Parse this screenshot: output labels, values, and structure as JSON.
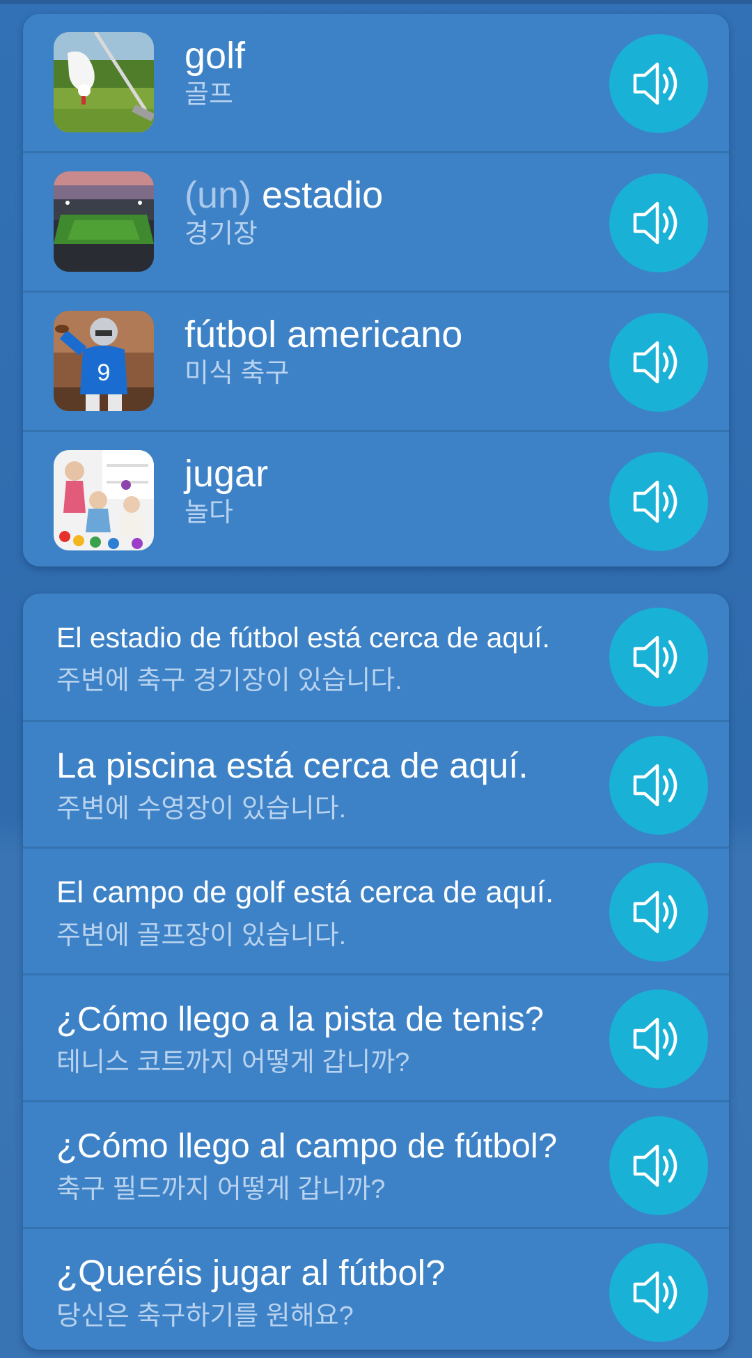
{
  "colors": {
    "card": "#3d82c6",
    "background": "#3271b5",
    "speaker_button": "#19b1d6",
    "article_text": "#a9c8ea",
    "translation_text": "#b8d2ef"
  },
  "vocabulary": [
    {
      "article": "",
      "term": "golf",
      "translation": "골프",
      "image": "golf-photo",
      "icon": "speaker-icon"
    },
    {
      "article": "(un)",
      "term": "estadio",
      "translation": "경기장",
      "image": "stadium-photo",
      "icon": "speaker-icon"
    },
    {
      "article": "",
      "term": "fútbol americano",
      "translation": "미식 축구",
      "image": "american-football-photo",
      "icon": "speaker-icon"
    },
    {
      "article": "",
      "term": "jugar",
      "translation": "놀다",
      "image": "children-playing-photo",
      "icon": "speaker-icon"
    }
  ],
  "phrases": [
    {
      "text": "El estadio de fútbol está cerca de aquí.",
      "translation": "주변에 축구 경기장이 있습니다.",
      "icon": "speaker-icon"
    },
    {
      "text": "La piscina está cerca de aquí.",
      "translation": "주변에 수영장이 있습니다.",
      "icon": "speaker-icon"
    },
    {
      "text": "El campo de golf está cerca de aquí.",
      "translation": "주변에 골프장이 있습니다.",
      "icon": "speaker-icon"
    },
    {
      "text": "¿Cómo llego a la pista de tenis?",
      "translation": "테니스 코트까지 어떻게 갑니까?",
      "icon": "speaker-icon"
    },
    {
      "text": "¿Cómo llego al campo de fútbol?",
      "translation": "축구 필드까지 어떻게 갑니까?",
      "icon": "speaker-icon"
    },
    {
      "text": "¿Queréis jugar al fútbol?",
      "translation": "당신은 축구하기를 원해요?",
      "icon": "speaker-icon"
    }
  ]
}
